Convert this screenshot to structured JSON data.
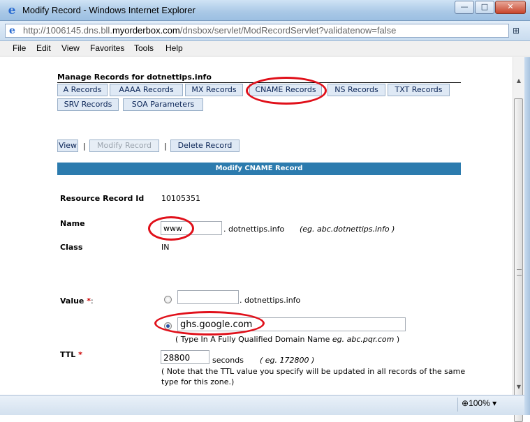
{
  "window": {
    "title": "Modify Record - Windows Internet Explorer",
    "buttons": {
      "minimize": "—",
      "maximize": "□",
      "close": "✕"
    }
  },
  "address": {
    "prefix": "http://1006145.dns.bll.",
    "host": "myorderbox.com",
    "suffix": "/dnsbox/servlet/ModRecordServlet?validatenow=false"
  },
  "menu": [
    "File",
    "Edit",
    "View",
    "Favorites",
    "Tools",
    "Help"
  ],
  "page": {
    "heading": "Manage Records for dotnettips.info",
    "record_tabs": [
      "A Records",
      "AAAA Records",
      "MX Records",
      "CNAME Records",
      "NS Records",
      "TXT Records",
      "SRV Records",
      "SOA Parameters"
    ],
    "actions": {
      "view": "View",
      "modify": "Modify Record",
      "delete": "Delete Record",
      "separator": "|"
    },
    "form_title": "Modify CNAME Record",
    "resource_id_label": "Resource Record Id",
    "resource_id_value": "10105351",
    "name_label": "Name",
    "name_value": "www",
    "name_suffix": ". dotnettips.info",
    "name_hint": "(eg. abc.dotnettips.info )",
    "class_label": "Class",
    "class_value": "IN",
    "value_label": "Value",
    "required_mark": "*",
    "value_colon": ":",
    "value_option1_input": "",
    "value_option1_suffix": ". dotnettips.info",
    "value_option2_input": "ghs.google.com",
    "value_hint_prefix": "( Type In A Fully Qualified Domain Name ",
    "value_hint_example": "eg. abc.pqr.com",
    "value_hint_suffix": ")",
    "ttl_label": "TTL",
    "ttl_value": "28800",
    "ttl_unit": "seconds",
    "ttl_hint": "( eg. 172800 )",
    "ttl_note_line1": "( Note that the TTL value you specify will be updated in all records of the same",
    "ttl_note_line2": "type for this zone.)"
  },
  "status": {
    "zoom": "100%"
  },
  "colors": {
    "annotation": "#e0101a",
    "form_header": "#2c7bae"
  }
}
